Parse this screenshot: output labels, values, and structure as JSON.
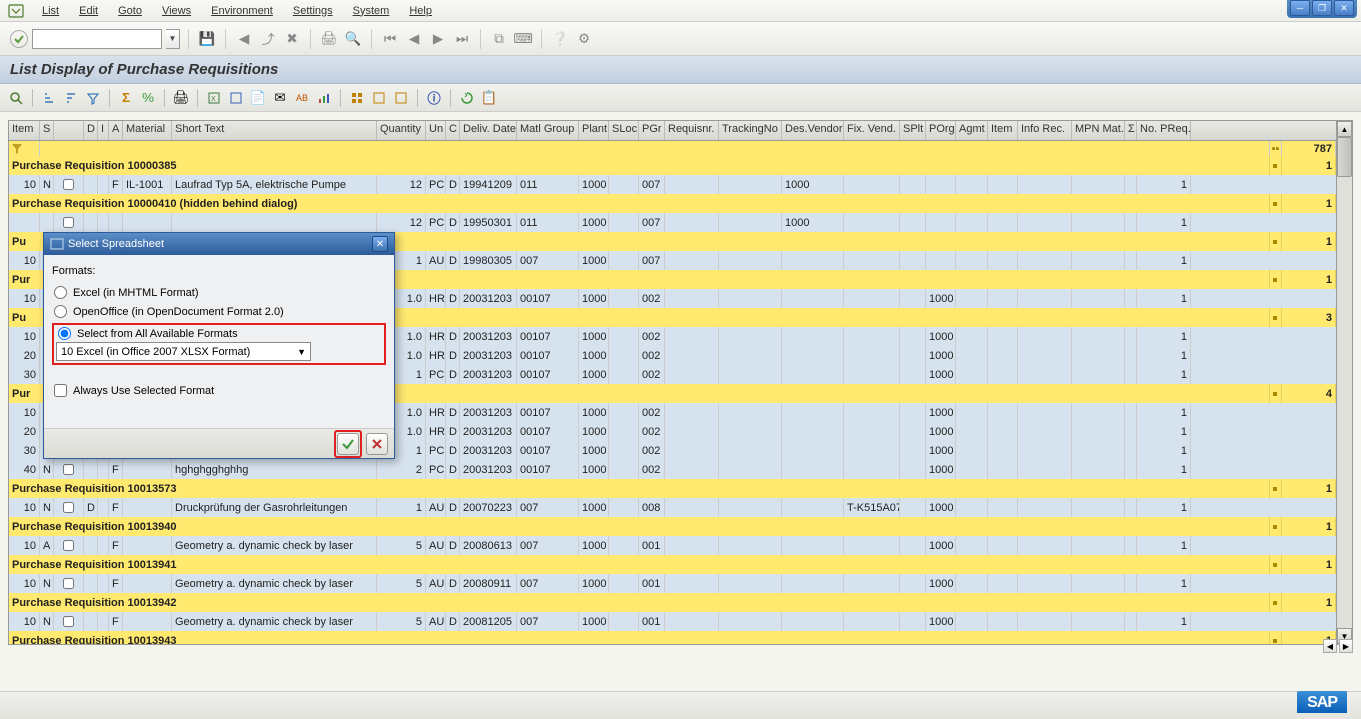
{
  "menu": {
    "items": [
      "List",
      "Edit",
      "Goto",
      "Views",
      "Environment",
      "Settings",
      "System",
      "Help"
    ]
  },
  "page_title": "List Display of Purchase Requisitions",
  "columns": [
    "Item",
    "S",
    "",
    "D",
    "I",
    "A",
    "Material",
    "Short Text",
    "Quantity",
    "Un",
    "C",
    "Deliv. Date",
    "Matl Group",
    "Plant",
    "SLoc",
    "PGr",
    "Requisnr.",
    "TrackingNo",
    "Des.Vendor",
    "Fix. Vend.",
    "SPlt",
    "POrg",
    "Agmt",
    "Item",
    "Info Rec.",
    "MPN Mat.",
    "Σ",
    "No. PReq."
  ],
  "total_no_preq": "787",
  "groups": [
    {
      "header": "Purchase Requisition 10000385",
      "sum": "1",
      "rows": [
        {
          "item": "10",
          "s": "N",
          "d": "",
          "i": "",
          "a": "F",
          "mat": "IL-1001",
          "short": "Laufrad Typ 5A, elektrische Pumpe",
          "qty": "12",
          "un": "PC",
          "c": "D",
          "deliv": "19941209",
          "matg": "011",
          "plant": "1000",
          "sloc": "",
          "pgr": "007",
          "req": "",
          "track": "",
          "dven": "1000",
          "fven": "",
          "splt": "",
          "porg": "",
          "agmt": "",
          "item2": "",
          "info": "",
          "mpn": "",
          "nopreq": "1"
        }
      ]
    },
    {
      "header": "Purchase Requisition 10000410 (hidden behind dialog)",
      "sum": "1",
      "rows": [
        {
          "item": "",
          "s": "",
          "d": "",
          "i": "",
          "a": "",
          "mat": "",
          "short": "",
          "qty": "12",
          "un": "PC",
          "c": "D",
          "deliv": "19950301",
          "matg": "011",
          "plant": "1000",
          "sloc": "",
          "pgr": "007",
          "req": "",
          "track": "",
          "dven": "1000",
          "fven": "",
          "splt": "",
          "porg": "",
          "agmt": "",
          "item2": "",
          "info": "",
          "mpn": "",
          "nopreq": "1"
        }
      ]
    },
    {
      "header": "Pu",
      "sum": "1",
      "rows": [
        {
          "item": "10",
          "s": "",
          "d": "",
          "i": "",
          "a": "",
          "mat": "",
          "short": "",
          "qty": "1",
          "un": "AU",
          "c": "D",
          "deliv": "19980305",
          "matg": "007",
          "plant": "1000",
          "sloc": "",
          "pgr": "007",
          "req": "",
          "track": "",
          "dven": "",
          "fven": "",
          "splt": "",
          "porg": "",
          "agmt": "",
          "item2": "",
          "info": "",
          "mpn": "",
          "nopreq": "1"
        }
      ]
    },
    {
      "header": "Pur",
      "sum": "1",
      "rows": [
        {
          "item": "10",
          "s": "",
          "d": "",
          "i": "",
          "a": "",
          "mat": "",
          "short": "",
          "qty": "1.0",
          "un": "HR",
          "c": "D",
          "deliv": "20031203",
          "matg": "00107",
          "plant": "1000",
          "sloc": "",
          "pgr": "002",
          "req": "",
          "track": "",
          "dven": "",
          "fven": "",
          "splt": "",
          "porg": "1000",
          "agmt": "",
          "item2": "",
          "info": "",
          "mpn": "",
          "nopreq": "1"
        }
      ]
    },
    {
      "header": "Pu",
      "sum": "3",
      "rows": [
        {
          "item": "10",
          "s": "",
          "d": "",
          "i": "",
          "a": "",
          "mat": "",
          "short": "",
          "qty": "1.0",
          "un": "HR",
          "c": "D",
          "deliv": "20031203",
          "matg": "00107",
          "plant": "1000",
          "sloc": "",
          "pgr": "002",
          "req": "",
          "track": "",
          "dven": "",
          "fven": "",
          "splt": "",
          "porg": "1000",
          "agmt": "",
          "item2": "",
          "info": "",
          "mpn": "",
          "nopreq": "1"
        },
        {
          "item": "20",
          "s": "",
          "d": "",
          "i": "",
          "a": "",
          "mat": "",
          "short": "",
          "qty": "1.0",
          "un": "HR",
          "c": "D",
          "deliv": "20031203",
          "matg": "00107",
          "plant": "1000",
          "sloc": "",
          "pgr": "002",
          "req": "",
          "track": "",
          "dven": "",
          "fven": "",
          "splt": "",
          "porg": "1000",
          "agmt": "",
          "item2": "",
          "info": "",
          "mpn": "",
          "nopreq": "1"
        },
        {
          "item": "30",
          "s": "",
          "d": "",
          "i": "",
          "a": "",
          "mat": "",
          "short": "",
          "qty": "1",
          "un": "PC",
          "c": "D",
          "deliv": "20031203",
          "matg": "00107",
          "plant": "1000",
          "sloc": "",
          "pgr": "002",
          "req": "",
          "track": "",
          "dven": "",
          "fven": "",
          "splt": "",
          "porg": "1000",
          "agmt": "",
          "item2": "",
          "info": "",
          "mpn": "",
          "nopreq": "1"
        }
      ]
    },
    {
      "header": "Pur",
      "sum": "4",
      "rows": [
        {
          "item": "10",
          "s": "",
          "d": "",
          "i": "",
          "a": "",
          "mat": "",
          "short": "",
          "qty": "1.0",
          "un": "HR",
          "c": "D",
          "deliv": "20031203",
          "matg": "00107",
          "plant": "1000",
          "sloc": "",
          "pgr": "002",
          "req": "",
          "track": "",
          "dven": "",
          "fven": "",
          "splt": "",
          "porg": "1000",
          "agmt": "",
          "item2": "",
          "info": "",
          "mpn": "",
          "nopreq": "1"
        },
        {
          "item": "20",
          "s": "",
          "d": "",
          "i": "",
          "a": "",
          "mat": "",
          "short": "",
          "qty": "1.0",
          "un": "HR",
          "c": "D",
          "deliv": "20031203",
          "matg": "00107",
          "plant": "1000",
          "sloc": "",
          "pgr": "002",
          "req": "",
          "track": "",
          "dven": "",
          "fven": "",
          "splt": "",
          "porg": "1000",
          "agmt": "",
          "item2": "",
          "info": "",
          "mpn": "",
          "nopreq": "1"
        },
        {
          "item": "30",
          "s": "",
          "d": "",
          "i": "",
          "a": "",
          "mat": "",
          "short": "",
          "qty": "1",
          "un": "PC",
          "c": "D",
          "deliv": "20031203",
          "matg": "00107",
          "plant": "1000",
          "sloc": "",
          "pgr": "002",
          "req": "",
          "track": "",
          "dven": "",
          "fven": "",
          "splt": "",
          "porg": "1000",
          "agmt": "",
          "item2": "",
          "info": "",
          "mpn": "",
          "nopreq": "1"
        },
        {
          "item": "40",
          "s": "N",
          "d": "",
          "i": "",
          "a": "F",
          "mat": "",
          "short": "hghghgghghhg",
          "qty": "2",
          "un": "PC",
          "c": "D",
          "deliv": "20031203",
          "matg": "00107",
          "plant": "1000",
          "sloc": "",
          "pgr": "002",
          "req": "",
          "track": "",
          "dven": "",
          "fven": "",
          "splt": "",
          "porg": "1000",
          "agmt": "",
          "item2": "",
          "info": "",
          "mpn": "",
          "nopreq": "1"
        }
      ]
    },
    {
      "header": "Purchase Requisition 10013573",
      "sum": "1",
      "rows": [
        {
          "item": "10",
          "s": "N",
          "d": "D",
          "i": "",
          "a": "F",
          "mat": "",
          "short": "Druckprüfung der Gasrohrleitungen",
          "qty": "1",
          "un": "AU",
          "c": "D",
          "deliv": "20070223",
          "matg": "007",
          "plant": "1000",
          "sloc": "",
          "pgr": "008",
          "req": "",
          "track": "",
          "dven": "",
          "fven": "T-K515A07",
          "splt": "",
          "porg": "1000",
          "agmt": "",
          "item2": "",
          "info": "",
          "mpn": "",
          "nopreq": "1"
        }
      ]
    },
    {
      "header": "Purchase Requisition 10013940",
      "sum": "1",
      "rows": [
        {
          "item": "10",
          "s": "A",
          "d": "",
          "i": "",
          "a": "F",
          "mat": "",
          "short": "Geometry a. dynamic check by laser",
          "qty": "5",
          "un": "AU",
          "c": "D",
          "deliv": "20080613",
          "matg": "007",
          "plant": "1000",
          "sloc": "",
          "pgr": "001",
          "req": "",
          "track": "",
          "dven": "",
          "fven": "",
          "splt": "",
          "porg": "1000",
          "agmt": "",
          "item2": "",
          "info": "",
          "mpn": "",
          "nopreq": "1"
        }
      ]
    },
    {
      "header": "Purchase Requisition 10013941",
      "sum": "1",
      "rows": [
        {
          "item": "10",
          "s": "N",
          "d": "",
          "i": "",
          "a": "F",
          "mat": "",
          "short": "Geometry a. dynamic check by laser",
          "qty": "5",
          "un": "AU",
          "c": "D",
          "deliv": "20080911",
          "matg": "007",
          "plant": "1000",
          "sloc": "",
          "pgr": "001",
          "req": "",
          "track": "",
          "dven": "",
          "fven": "",
          "splt": "",
          "porg": "1000",
          "agmt": "",
          "item2": "",
          "info": "",
          "mpn": "",
          "nopreq": "1"
        }
      ]
    },
    {
      "header": "Purchase Requisition 10013942",
      "sum": "1",
      "rows": [
        {
          "item": "10",
          "s": "N",
          "d": "",
          "i": "",
          "a": "F",
          "mat": "",
          "short": "Geometry a. dynamic check by laser",
          "qty": "5",
          "un": "AU",
          "c": "D",
          "deliv": "20081205",
          "matg": "007",
          "plant": "1000",
          "sloc": "",
          "pgr": "001",
          "req": "",
          "track": "",
          "dven": "",
          "fven": "",
          "splt": "",
          "porg": "1000",
          "agmt": "",
          "item2": "",
          "info": "",
          "mpn": "",
          "nopreq": "1"
        }
      ]
    },
    {
      "header": "Purchase Requisition 10013943",
      "sum": "1",
      "rows": []
    }
  ],
  "dialog": {
    "title": "Select Spreadsheet",
    "formats_label": "Formats:",
    "opt_mhtml": "Excel (in MHTML Format)",
    "opt_openoffice": "OpenOffice (in OpenDocument Format 2.0)",
    "opt_select_all": "Select from All Available Formats",
    "dropdown_value": "10 Excel (in Office 2007 XLSX Format)",
    "always_use": "Always Use Selected Format"
  },
  "footer_logo": "SAP"
}
